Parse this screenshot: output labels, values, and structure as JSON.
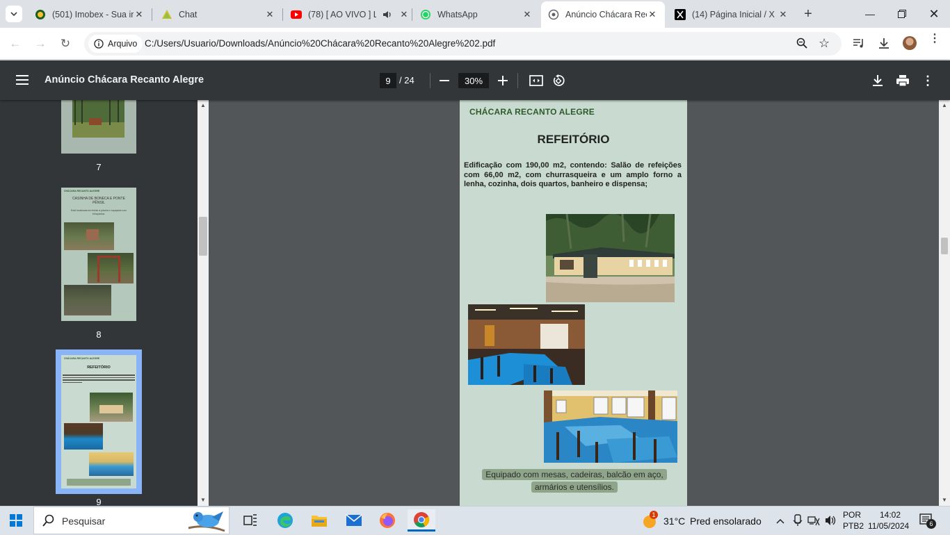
{
  "browser": {
    "tabs": [
      {
        "title": "(501) Imobex - Sua im",
        "icon": "imobex-icon"
      },
      {
        "title": "Chat",
        "icon": "chat-icon"
      },
      {
        "title": "(78) [ AO VIVO ] L",
        "icon": "youtube-icon"
      },
      {
        "title": "WhatsApp",
        "icon": "whatsapp-icon"
      },
      {
        "title": "Anúncio Chácara Rec",
        "icon": "globe-icon",
        "active": true
      },
      {
        "title": "(14) Página Inicial / X",
        "icon": "x-icon"
      }
    ],
    "origin_label": "Arquivo",
    "url": "C:/Users/Usuario/Downloads/Anúncio%20Chácara%20Recanto%20Alegre%202.pdf"
  },
  "pdf": {
    "title": "Anúncio Chácara Recanto Alegre",
    "current_page": "9",
    "total_pages": "/ 24",
    "zoom": "30%"
  },
  "thumbnails": [
    {
      "page": "7"
    },
    {
      "page": "8",
      "heading": "CASINHA DE BONECA E PONTE PÊNSIL",
      "brand": "CHÁCARA RECANTO ALEGRE",
      "desc": "Está localizada em frente à piscina e equipada com brinquedos."
    },
    {
      "page": "9",
      "heading": "REFEITÓRIO",
      "brand": "CHÁCARA RECANTO ALEGRE"
    }
  ],
  "page_content": {
    "brand": "CHÁCARA RECANTO ALEGRE",
    "title": "REFEITÓRIO",
    "description": "Edificação com 190,00 m2, contendo: Salão de refeições com 66,00 m2, com churrasqueira e um amplo forno a lenha, cozinha, dois quartos, banheiro e dispensa;",
    "caption_line1": "Equipado com mesas, cadeiras, balcão em aço,",
    "caption_line2": "armários e utensílios."
  },
  "taskbar": {
    "search_placeholder": "Pesquisar",
    "weather_temp": "31°C",
    "weather_desc": "Pred ensolarado",
    "lang": "POR",
    "layout": "PTB2",
    "time": "14:02",
    "date": "11/05/2024",
    "notif_count": "6",
    "weather_badge": "1"
  }
}
